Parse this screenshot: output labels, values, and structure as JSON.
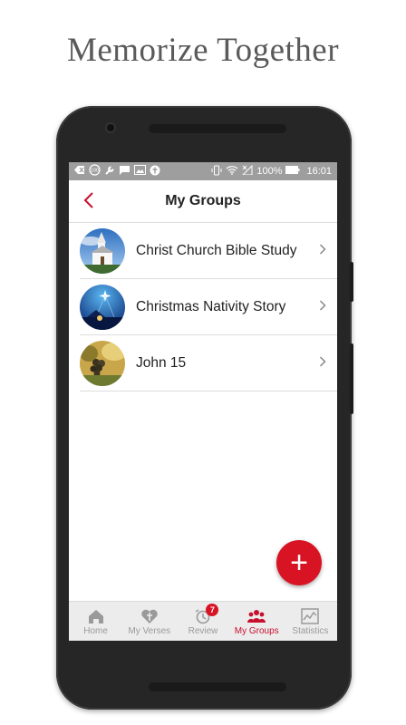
{
  "headline": "Memorize Together",
  "status_bar": {
    "left_icons": [
      "back-arrow-icon",
      "battery-saver-icon",
      "wrench-icon",
      "message-icon",
      "image-icon",
      "cross-icon"
    ],
    "battery": "100%",
    "time": "16:01"
  },
  "appbar": {
    "title": "My Groups"
  },
  "groups": [
    {
      "name": "Christ Church Bible Study",
      "thumb": "church-thumbnail"
    },
    {
      "name": "Christmas Nativity Story",
      "thumb": "nativity-thumbnail"
    },
    {
      "name": "John 15",
      "thumb": "grapes-thumbnail"
    }
  ],
  "fab": {
    "label": "+"
  },
  "bottom_nav": {
    "items": [
      {
        "label": "Home",
        "icon": "home-icon",
        "active": false
      },
      {
        "label": "My Verses",
        "icon": "heart-cross-icon",
        "active": false
      },
      {
        "label": "Review",
        "icon": "alarm-icon",
        "active": false,
        "badge": "7"
      },
      {
        "label": "My Groups",
        "icon": "group-icon",
        "active": true
      },
      {
        "label": "Statistics",
        "icon": "chart-icon",
        "active": false
      }
    ]
  },
  "colors": {
    "accent": "#c8102e",
    "fab": "#d81424",
    "status_bar": "#9e9e9e",
    "nav_bg": "#ececec"
  }
}
